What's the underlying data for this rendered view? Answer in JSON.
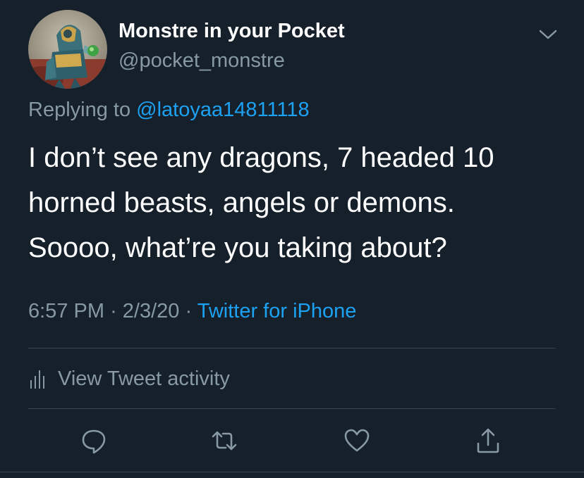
{
  "author": {
    "display_name": "Monstre in your Pocket",
    "handle": "@pocket_monstre",
    "avatar_icon": "armored-figure-avatar"
  },
  "reply": {
    "prefix": "Replying to ",
    "mention": "@latoyaa14811118"
  },
  "tweet": {
    "lines": [
      "I don’t see any dragons, 7 headed 10",
      "horned beasts, angels or demons.",
      "Soooo, what’re you taking about?"
    ]
  },
  "meta": {
    "time": "6:57 PM",
    "date": "2/3/20",
    "separator": "·",
    "source": "Twitter for iPhone"
  },
  "activity": {
    "label": "View Tweet activity",
    "icon": "bar-chart-icon"
  },
  "actions": [
    {
      "name": "reply",
      "icon": "speech-bubble-icon"
    },
    {
      "name": "retweet",
      "icon": "retweet-icon"
    },
    {
      "name": "like",
      "icon": "heart-icon"
    },
    {
      "name": "share",
      "icon": "share-upload-icon"
    }
  ],
  "colors": {
    "background": "#15202b",
    "text_primary": "#ffffff",
    "text_secondary": "#8899a6",
    "accent_blue": "#1da1f2",
    "divider": "#38444d"
  }
}
